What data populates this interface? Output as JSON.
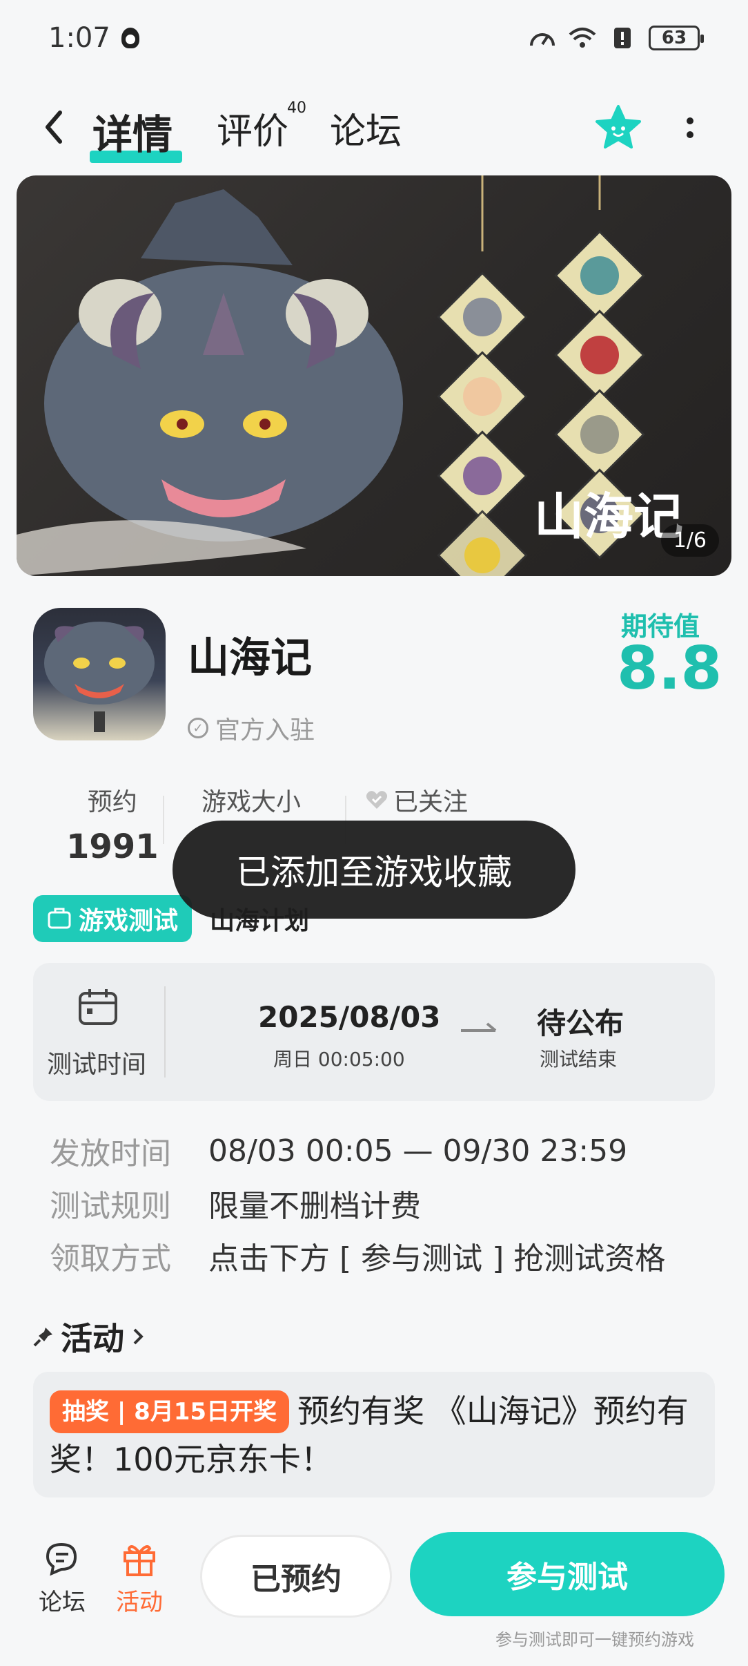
{
  "status_bar": {
    "time": "1:07",
    "battery": "63"
  },
  "header": {
    "tabs": [
      {
        "label": "详情",
        "active": true
      },
      {
        "label": "评价",
        "badge": "40"
      },
      {
        "label": "论坛"
      }
    ],
    "back_icon": "chevron-left-icon",
    "favorite_icon": "star-icon",
    "more_icon": "more-vertical-icon",
    "accent_color": "#1dd3c1"
  },
  "banner": {
    "logo_text": "山海记",
    "counter": "1/6"
  },
  "game": {
    "title": "山海记",
    "official_label": "官方入驻",
    "expect_label": "期待值",
    "expect_value": "8.8"
  },
  "stats": {
    "reserve_label": "预约",
    "reserve_value": "1991",
    "size_label": "游戏大小",
    "follow_label": "已关注"
  },
  "tag": {
    "label": "游戏测试",
    "text": "山海计划"
  },
  "toast": {
    "message": "已添加至游戏收藏"
  },
  "test_time": {
    "label": "测试时间",
    "start_date": "2025/08/03",
    "start_sub": "周日  00:05:00",
    "end_date": "待公布",
    "end_sub": "测试结束"
  },
  "info_rows": [
    {
      "label": "发放时间",
      "value": "08/03 00:05 — 09/30 23:59"
    },
    {
      "label": "测试规则",
      "value": "限量不删档计费"
    },
    {
      "label": "领取方式",
      "value": "点击下方 [ 参与测试 ] 抢测试资格"
    }
  ],
  "activity": {
    "heading": "活动",
    "tag": "抽奖 | 8月15日开奖",
    "text": "预约有奖 《山海记》预约有奖！100元京东卡！",
    "tag_color": "#ff6b35"
  },
  "bottom_bar": {
    "forum_label": "论坛",
    "activity_label": "活动",
    "reserved_button": "已预约",
    "join_button": "参与测试",
    "join_hint": "参与测试即可一键预约游戏"
  }
}
